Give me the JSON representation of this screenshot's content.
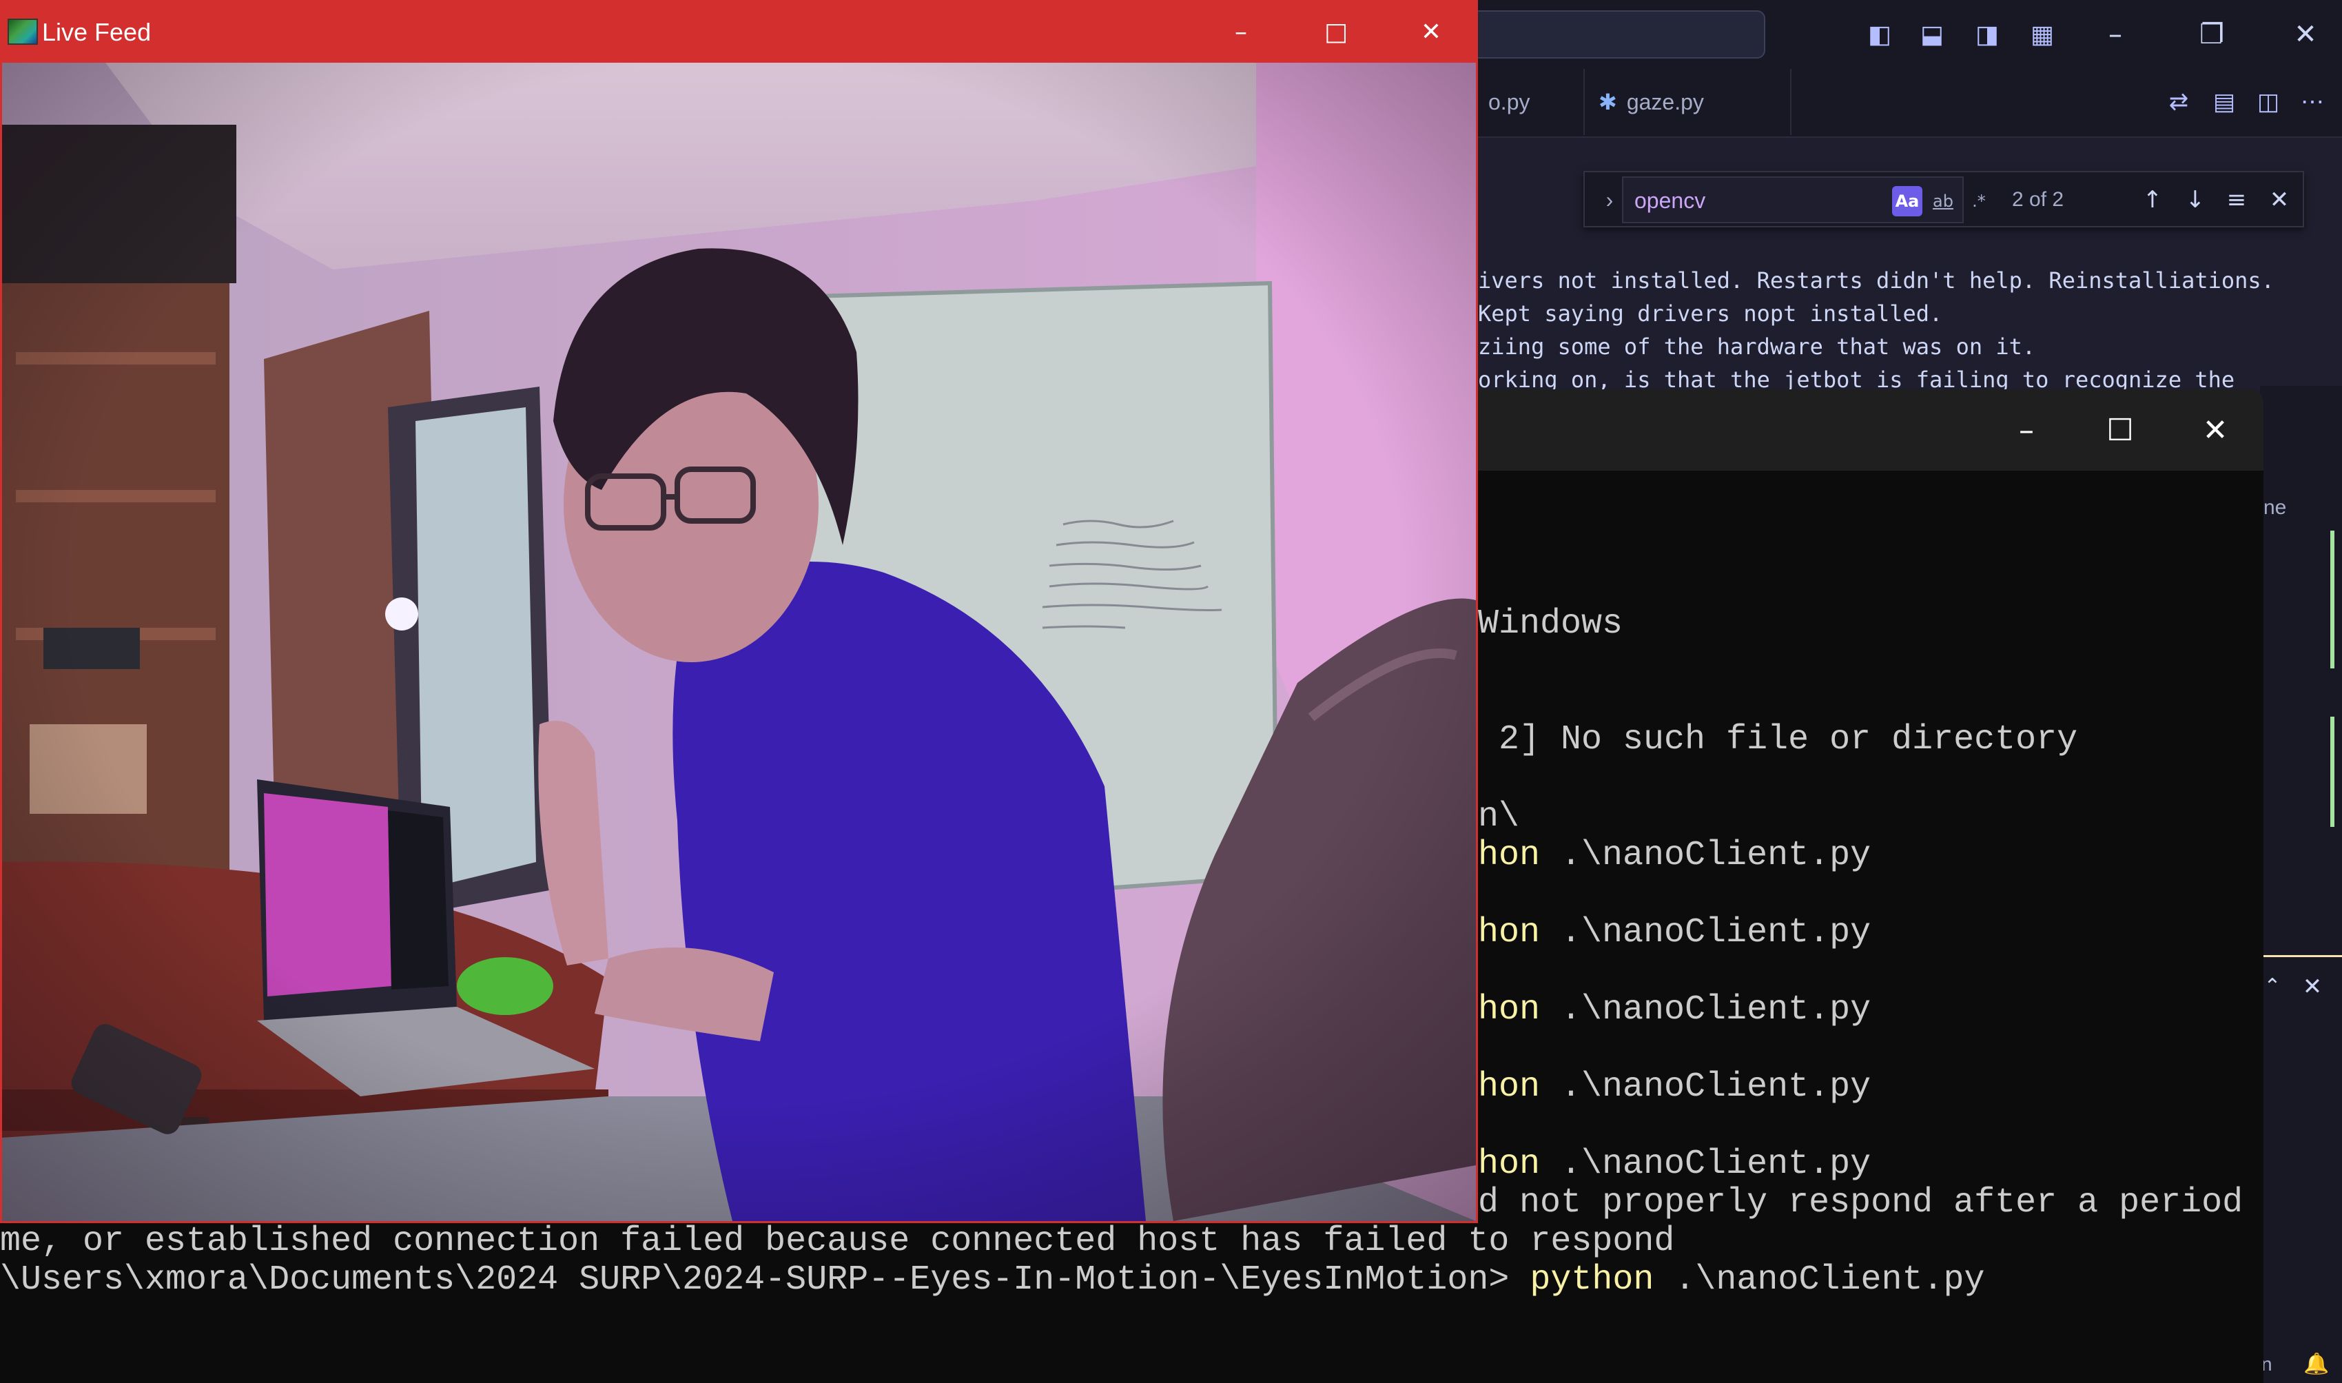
{
  "vscode": {
    "tabs": [
      {
        "label": "o.py"
      },
      {
        "label": "gaze.py"
      }
    ],
    "find": {
      "query": "opencv",
      "match_case": "Aa",
      "whole_word": "ab",
      "regex": ".*",
      "count": "2 of 2"
    },
    "editor_lines": [
      "ivers not installed. Restarts didn't help. Reinstalliations.",
      "Kept saying drivers nopt installed.",
      "ziing some of the hardware that was on it.",
      "orking on, is that the jetbot is failing to recognize the"
    ],
    "rail_text": "ne",
    "status_fragment": "n"
  },
  "terminal": {
    "lines": [
      {
        "text": "Windows",
        "kw": "",
        "rest": ""
      },
      {
        "text": " 2] No such file or directory",
        "kw": "",
        "rest": ""
      },
      {
        "text": "n\\",
        "kw": "",
        "rest": ""
      },
      {
        "text": "",
        "kw": "hon",
        "rest": " .\\nanoClient.py"
      },
      {
        "text": "",
        "kw": "hon",
        "rest": " .\\nanoClient.py"
      },
      {
        "text": "",
        "kw": "hon",
        "rest": " .\\nanoClient.py"
      },
      {
        "text": "",
        "kw": "hon",
        "rest": " .\\nanoClient.py"
      },
      {
        "text": "",
        "kw": "hon",
        "rest": " .\\nanoClient.py"
      },
      {
        "text": "d not properly respond after a period",
        "kw": "",
        "rest": ""
      },
      {
        "text": "me, or established connection failed because connected host has failed to respond",
        "kw": "",
        "rest": ""
      },
      {
        "text": "\\Users\\xmora\\Documents\\2024 SURP\\2024-SURP--Eyes-In-Motion-\\EyesInMotion> ",
        "kw": "python",
        "rest": " .\\nanoClient.py"
      }
    ]
  },
  "livefeed": {
    "title": "Live Feed"
  }
}
